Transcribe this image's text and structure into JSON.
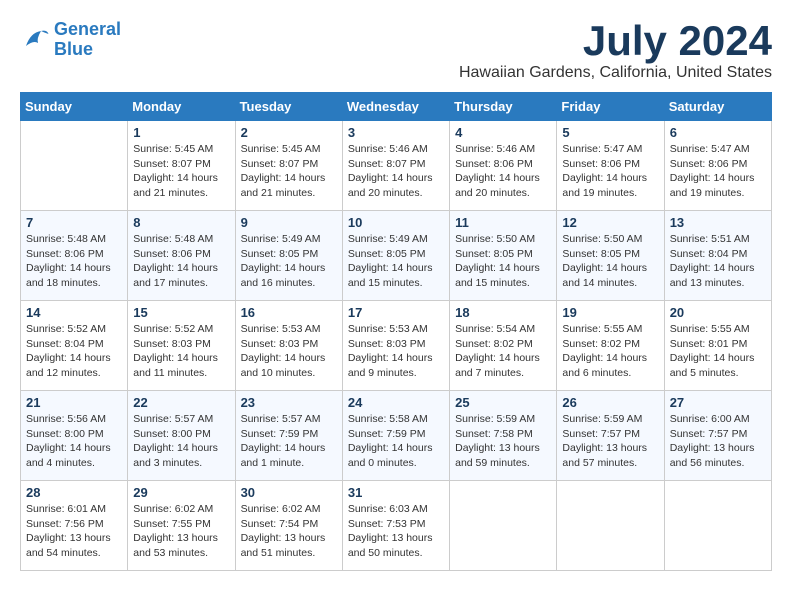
{
  "logo": {
    "line1": "General",
    "line2": "Blue"
  },
  "title": "July 2024",
  "subtitle": "Hawaiian Gardens, California, United States",
  "days_of_week": [
    "Sunday",
    "Monday",
    "Tuesday",
    "Wednesday",
    "Thursday",
    "Friday",
    "Saturday"
  ],
  "weeks": [
    [
      {
        "day": "",
        "sunrise": "",
        "sunset": "",
        "daylight": ""
      },
      {
        "day": "1",
        "sunrise": "Sunrise: 5:45 AM",
        "sunset": "Sunset: 8:07 PM",
        "daylight": "Daylight: 14 hours and 21 minutes."
      },
      {
        "day": "2",
        "sunrise": "Sunrise: 5:45 AM",
        "sunset": "Sunset: 8:07 PM",
        "daylight": "Daylight: 14 hours and 21 minutes."
      },
      {
        "day": "3",
        "sunrise": "Sunrise: 5:46 AM",
        "sunset": "Sunset: 8:07 PM",
        "daylight": "Daylight: 14 hours and 20 minutes."
      },
      {
        "day": "4",
        "sunrise": "Sunrise: 5:46 AM",
        "sunset": "Sunset: 8:06 PM",
        "daylight": "Daylight: 14 hours and 20 minutes."
      },
      {
        "day": "5",
        "sunrise": "Sunrise: 5:47 AM",
        "sunset": "Sunset: 8:06 PM",
        "daylight": "Daylight: 14 hours and 19 minutes."
      },
      {
        "day": "6",
        "sunrise": "Sunrise: 5:47 AM",
        "sunset": "Sunset: 8:06 PM",
        "daylight": "Daylight: 14 hours and 19 minutes."
      }
    ],
    [
      {
        "day": "7",
        "sunrise": "Sunrise: 5:48 AM",
        "sunset": "Sunset: 8:06 PM",
        "daylight": "Daylight: 14 hours and 18 minutes."
      },
      {
        "day": "8",
        "sunrise": "Sunrise: 5:48 AM",
        "sunset": "Sunset: 8:06 PM",
        "daylight": "Daylight: 14 hours and 17 minutes."
      },
      {
        "day": "9",
        "sunrise": "Sunrise: 5:49 AM",
        "sunset": "Sunset: 8:05 PM",
        "daylight": "Daylight: 14 hours and 16 minutes."
      },
      {
        "day": "10",
        "sunrise": "Sunrise: 5:49 AM",
        "sunset": "Sunset: 8:05 PM",
        "daylight": "Daylight: 14 hours and 15 minutes."
      },
      {
        "day": "11",
        "sunrise": "Sunrise: 5:50 AM",
        "sunset": "Sunset: 8:05 PM",
        "daylight": "Daylight: 14 hours and 15 minutes."
      },
      {
        "day": "12",
        "sunrise": "Sunrise: 5:50 AM",
        "sunset": "Sunset: 8:05 PM",
        "daylight": "Daylight: 14 hours and 14 minutes."
      },
      {
        "day": "13",
        "sunrise": "Sunrise: 5:51 AM",
        "sunset": "Sunset: 8:04 PM",
        "daylight": "Daylight: 14 hours and 13 minutes."
      }
    ],
    [
      {
        "day": "14",
        "sunrise": "Sunrise: 5:52 AM",
        "sunset": "Sunset: 8:04 PM",
        "daylight": "Daylight: 14 hours and 12 minutes."
      },
      {
        "day": "15",
        "sunrise": "Sunrise: 5:52 AM",
        "sunset": "Sunset: 8:03 PM",
        "daylight": "Daylight: 14 hours and 11 minutes."
      },
      {
        "day": "16",
        "sunrise": "Sunrise: 5:53 AM",
        "sunset": "Sunset: 8:03 PM",
        "daylight": "Daylight: 14 hours and 10 minutes."
      },
      {
        "day": "17",
        "sunrise": "Sunrise: 5:53 AM",
        "sunset": "Sunset: 8:03 PM",
        "daylight": "Daylight: 14 hours and 9 minutes."
      },
      {
        "day": "18",
        "sunrise": "Sunrise: 5:54 AM",
        "sunset": "Sunset: 8:02 PM",
        "daylight": "Daylight: 14 hours and 7 minutes."
      },
      {
        "day": "19",
        "sunrise": "Sunrise: 5:55 AM",
        "sunset": "Sunset: 8:02 PM",
        "daylight": "Daylight: 14 hours and 6 minutes."
      },
      {
        "day": "20",
        "sunrise": "Sunrise: 5:55 AM",
        "sunset": "Sunset: 8:01 PM",
        "daylight": "Daylight: 14 hours and 5 minutes."
      }
    ],
    [
      {
        "day": "21",
        "sunrise": "Sunrise: 5:56 AM",
        "sunset": "Sunset: 8:00 PM",
        "daylight": "Daylight: 14 hours and 4 minutes."
      },
      {
        "day": "22",
        "sunrise": "Sunrise: 5:57 AM",
        "sunset": "Sunset: 8:00 PM",
        "daylight": "Daylight: 14 hours and 3 minutes."
      },
      {
        "day": "23",
        "sunrise": "Sunrise: 5:57 AM",
        "sunset": "Sunset: 7:59 PM",
        "daylight": "Daylight: 14 hours and 1 minute."
      },
      {
        "day": "24",
        "sunrise": "Sunrise: 5:58 AM",
        "sunset": "Sunset: 7:59 PM",
        "daylight": "Daylight: 14 hours and 0 minutes."
      },
      {
        "day": "25",
        "sunrise": "Sunrise: 5:59 AM",
        "sunset": "Sunset: 7:58 PM",
        "daylight": "Daylight: 13 hours and 59 minutes."
      },
      {
        "day": "26",
        "sunrise": "Sunrise: 5:59 AM",
        "sunset": "Sunset: 7:57 PM",
        "daylight": "Daylight: 13 hours and 57 minutes."
      },
      {
        "day": "27",
        "sunrise": "Sunrise: 6:00 AM",
        "sunset": "Sunset: 7:57 PM",
        "daylight": "Daylight: 13 hours and 56 minutes."
      }
    ],
    [
      {
        "day": "28",
        "sunrise": "Sunrise: 6:01 AM",
        "sunset": "Sunset: 7:56 PM",
        "daylight": "Daylight: 13 hours and 54 minutes."
      },
      {
        "day": "29",
        "sunrise": "Sunrise: 6:02 AM",
        "sunset": "Sunset: 7:55 PM",
        "daylight": "Daylight: 13 hours and 53 minutes."
      },
      {
        "day": "30",
        "sunrise": "Sunrise: 6:02 AM",
        "sunset": "Sunset: 7:54 PM",
        "daylight": "Daylight: 13 hours and 51 minutes."
      },
      {
        "day": "31",
        "sunrise": "Sunrise: 6:03 AM",
        "sunset": "Sunset: 7:53 PM",
        "daylight": "Daylight: 13 hours and 50 minutes."
      },
      {
        "day": "",
        "sunrise": "",
        "sunset": "",
        "daylight": ""
      },
      {
        "day": "",
        "sunrise": "",
        "sunset": "",
        "daylight": ""
      },
      {
        "day": "",
        "sunrise": "",
        "sunset": "",
        "daylight": ""
      }
    ]
  ]
}
